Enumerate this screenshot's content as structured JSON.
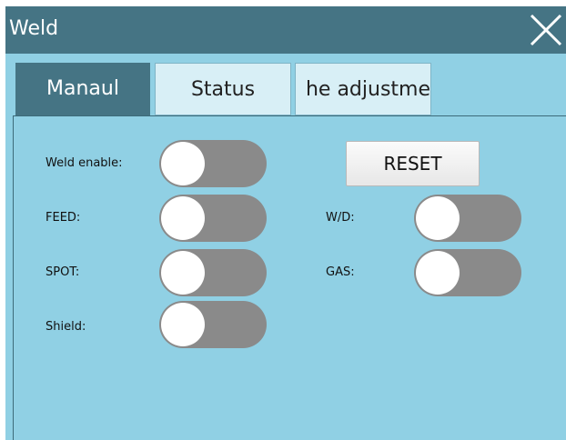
{
  "window": {
    "title": "Weld",
    "close_icon": "close-icon"
  },
  "tabs": [
    {
      "label": "Manaul",
      "active": true
    },
    {
      "label": "Status",
      "active": false
    },
    {
      "label": "he adjustme",
      "active": false
    }
  ],
  "controls": {
    "weld_enable": {
      "label": "Weld enable:",
      "on": false
    },
    "feed": {
      "label": "FEED:",
      "on": false
    },
    "spot": {
      "label": "SPOT:",
      "on": false
    },
    "shield": {
      "label": "Shield:",
      "on": false
    },
    "wd": {
      "label": "W/D:",
      "on": false
    },
    "gas": {
      "label": "GAS:",
      "on": false
    },
    "reset_label": "RESET"
  },
  "colors": {
    "titlebar": "#457484",
    "background": "#90d0e4",
    "active_tab": "#457484",
    "inactive_tab": "#d8eff6",
    "toggle_track_off": "#8a8a8a",
    "toggle_knob": "#ffffff"
  }
}
